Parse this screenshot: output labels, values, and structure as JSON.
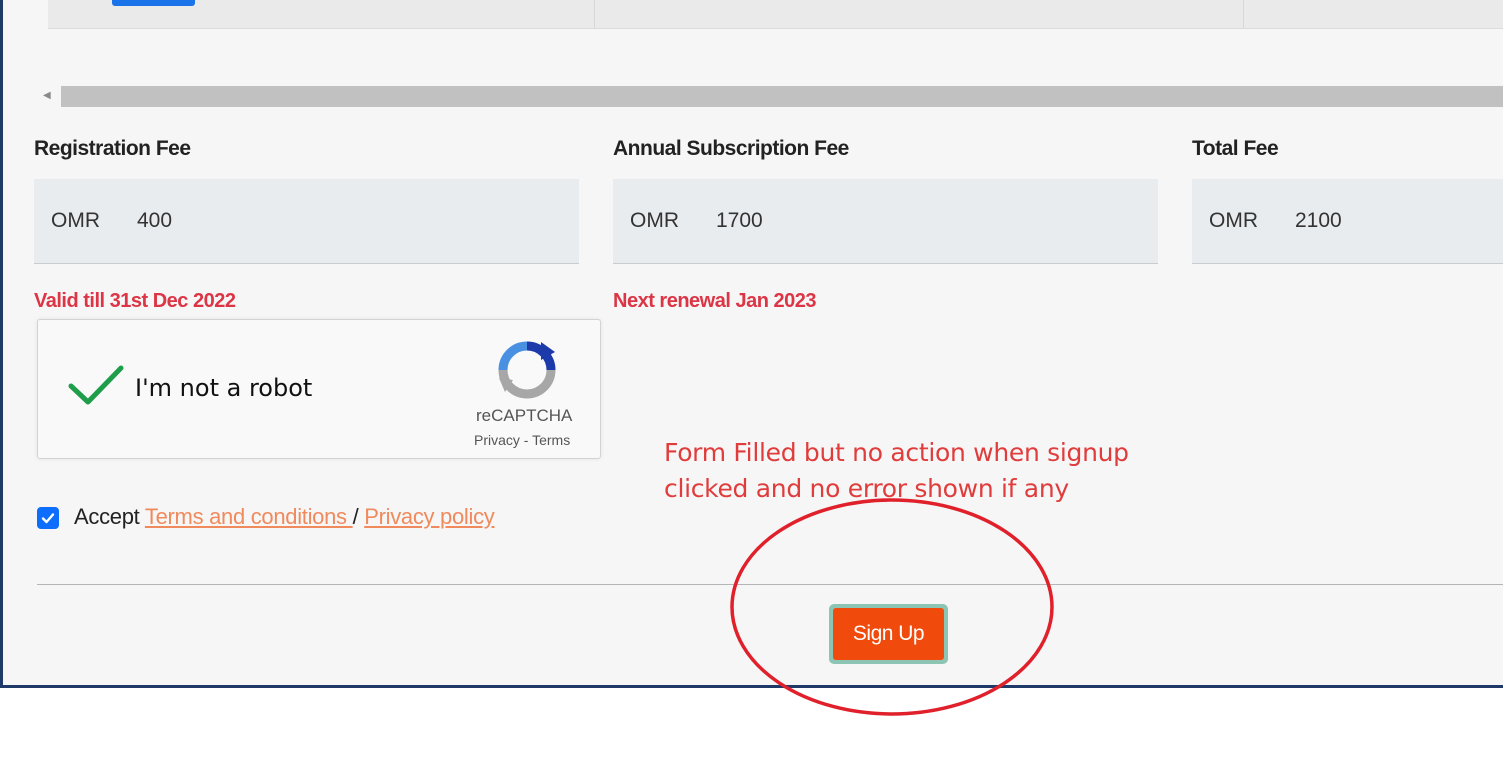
{
  "fees": {
    "registration": {
      "label": "Registration Fee",
      "currency": "OMR",
      "amount": "400",
      "note": "Valid till 31st Dec 2022"
    },
    "annual": {
      "label": "Annual Subscription Fee",
      "currency": "OMR",
      "amount": "1700",
      "note": "Next renewal Jan 2023"
    },
    "total": {
      "label": "Total Fee",
      "currency": "OMR",
      "amount": "2100"
    }
  },
  "recaptcha": {
    "label": "I'm not a robot",
    "brand": "reCAPTCHA",
    "privacy": "Privacy",
    "separator": " - ",
    "terms": "Terms",
    "checked": true
  },
  "accept": {
    "prefix": "Accept ",
    "terms_link": "Terms and conditions ",
    "separator": "/ ",
    "privacy_link": "Privacy policy",
    "checked": true
  },
  "signup": {
    "label": "Sign Up"
  },
  "annotation": {
    "line1": "Form Filled but no action when signup",
    "line2": "clicked and no error shown if any",
    "color": "#e03c3c"
  },
  "colors": {
    "primary": "#0d6efd",
    "danger": "#dc3545",
    "signup_bg": "#f04a0c",
    "link": "#f08a5d",
    "frame_border": "#1f3a68"
  }
}
